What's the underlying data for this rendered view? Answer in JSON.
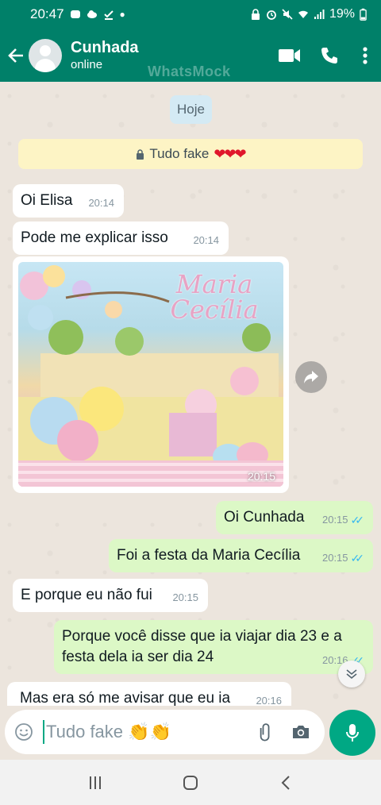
{
  "status_bar": {
    "time": "20:47",
    "battery": "19%"
  },
  "header": {
    "contact_name": "Cunhada",
    "contact_status": "online",
    "watermark": "WhatsMock"
  },
  "chat": {
    "date_chip": "Hoje",
    "notice": "Tudo fake",
    "notice_hearts": "❤❤❤",
    "messages": [
      {
        "text": "Oi Elisa",
        "time": "20:14"
      },
      {
        "text": "Pode me explicar isso",
        "time": "20:14"
      },
      {
        "image_title": "Maria Cecília",
        "time": "20:15"
      },
      {
        "text": "Oi Cunhada",
        "time": "20:15"
      },
      {
        "text": "Foi a festa da Maria Cecília",
        "time": "20:15"
      },
      {
        "text": "E porque eu não fui",
        "time": "20:15"
      },
      {
        "text": "Porque você disse que ia viajar dia 23 e a festa dela ia ser dia 24",
        "time": "20:16"
      },
      {
        "text": "Mas era só me avisar que eu ia",
        "time": "20:16"
      }
    ]
  },
  "input": {
    "draft_text": "Tudo fake",
    "draft_emoji": "👏👏"
  },
  "colors": {
    "header": "#008069",
    "outgoing_bubble": "#dcf8c6",
    "incoming_bubble": "#ffffff",
    "accent": "#00a884",
    "read_ticks": "#34b7f1"
  }
}
